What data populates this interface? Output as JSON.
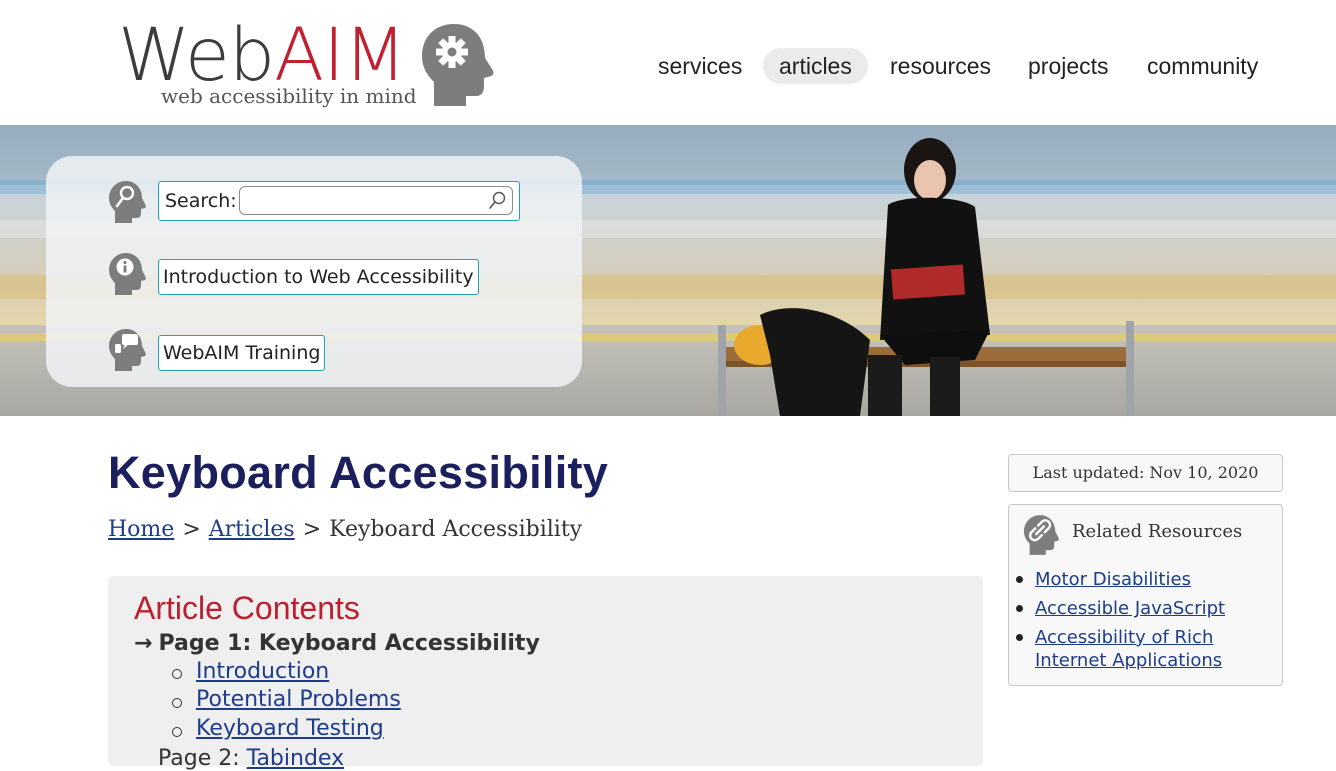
{
  "logo": {
    "word_web": "Web",
    "word_aim": "AIM",
    "tagline": "web accessibility in mind"
  },
  "nav": {
    "items": [
      {
        "label": "services",
        "active": false
      },
      {
        "label": "articles",
        "active": true
      },
      {
        "label": "resources",
        "active": false
      },
      {
        "label": "projects",
        "active": false
      },
      {
        "label": "community",
        "active": false
      }
    ]
  },
  "hero": {
    "search_label": "Search:",
    "search_value": "",
    "quick_links": [
      "Introduction to Web Accessibility",
      "WebAIM Training"
    ]
  },
  "page": {
    "title": "Keyboard Accessibility",
    "breadcrumb": [
      "Home",
      "Articles",
      "Keyboard Accessibility"
    ]
  },
  "toc": {
    "title": "Article Contents",
    "current_page": "Page 1: Keyboard Accessibility",
    "current_marker": "→",
    "sections": [
      "Introduction",
      "Potential Problems",
      "Keyboard Testing"
    ],
    "next_page_prefix": "Page 2: ",
    "next_page_link": "Tabindex"
  },
  "sidebar": {
    "last_updated": "Last updated: Nov 10, 2020",
    "related_title": "Related Resources",
    "related_links": [
      "Motor Disabilities",
      "Accessible JavaScript",
      "Accessibility of Rich Internet Applications"
    ]
  },
  "colors": {
    "brand_red": "#c21f31",
    "title_navy": "#1b1f5e",
    "link_blue": "#1d3c8c",
    "focus_teal": "#1fa4b7",
    "toc_red": "#bd1f2e"
  },
  "icons": {
    "logo_head": "gear-head-icon",
    "search": "magnifier-head-icon",
    "info": "info-head-icon",
    "training": "speech-bubble-head-icon",
    "related": "link-head-icon"
  }
}
